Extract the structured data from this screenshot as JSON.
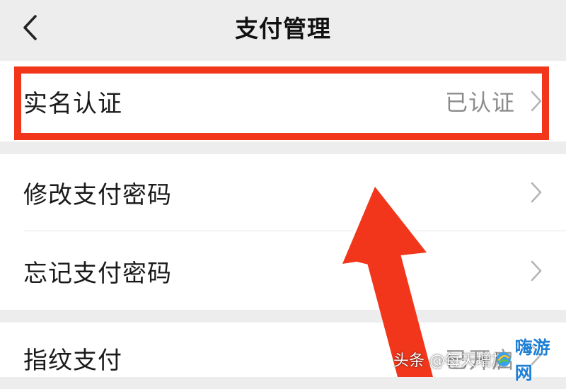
{
  "header": {
    "title": "支付管理",
    "back_icon": "chevron-left-icon"
  },
  "rows": [
    {
      "label": "实名认证",
      "value": "已认证",
      "icon": "chevron-right-icon"
    },
    {
      "label": "修改支付密码",
      "value": "",
      "icon": "chevron-right-icon"
    },
    {
      "label": "忘记支付密码",
      "value": "",
      "icon": "chevron-right-icon"
    },
    {
      "label": "指纹支付",
      "value": "已开启",
      "icon": "chevron-right-icon"
    }
  ],
  "annotation": {
    "highlight_color": "#f2361b",
    "arrow_color": "#f2361b"
  },
  "watermark": {
    "text": "头条 @每天增加",
    "site_logo_text": "嗨游网"
  }
}
